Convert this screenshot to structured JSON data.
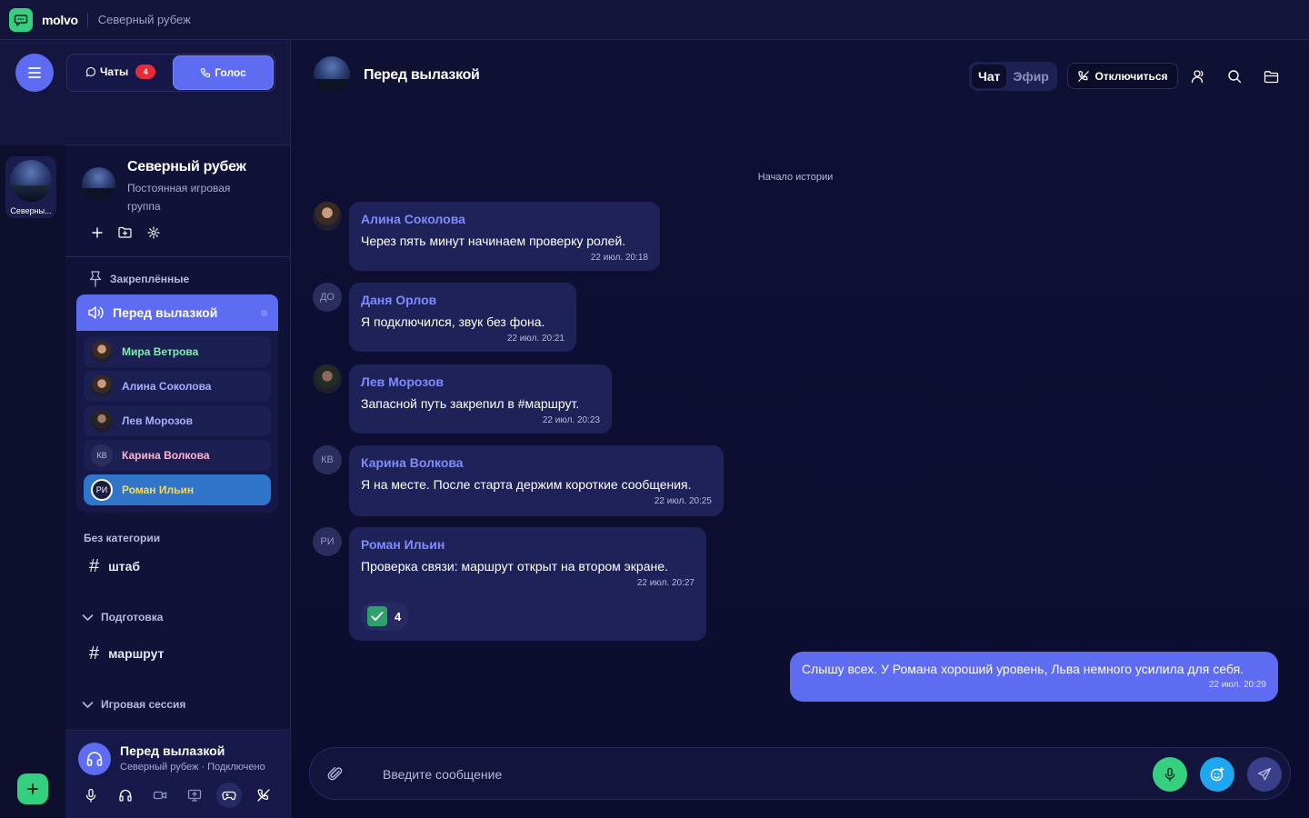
{
  "app": {
    "brand": "molvo",
    "context_title": "Северный рубеж"
  },
  "colors": {
    "accent": "#5d6cf0",
    "green": "#35d07f",
    "badge_red": "#e62b38",
    "active_user": "#2f75c9"
  },
  "mode": {
    "chats_label": "Чаты",
    "chats_count": "4",
    "voice_label": "Голос"
  },
  "server": {
    "rail_name": "Северны...",
    "title": "Северный рубеж",
    "description": "Постоянная игровая группа"
  },
  "pinned": {
    "label": "Закреплённые",
    "voice_channel": "Перед вылазкой",
    "participants": [
      {
        "name": "Мира Ветрова",
        "color": "#7ff0a8",
        "initials": ""
      },
      {
        "name": "Алина Соколова",
        "color": "#a5aeff",
        "initials": ""
      },
      {
        "name": "Лев Морозов",
        "color": "#a5aeff",
        "initials": ""
      },
      {
        "name": "Карина Волкова",
        "color": "#ffb3d0",
        "initials": "КВ"
      },
      {
        "name": "Роман Ильин",
        "color": "#ffd84d",
        "initials": "РИ"
      }
    ]
  },
  "categories": {
    "uncategorized": "Без категории",
    "ch_shtab": "штаб",
    "prep": "Подготовка",
    "ch_route": "маршрут",
    "session": "Игровая сессия"
  },
  "voice_panel": {
    "title": "Перед вылазкой",
    "subtitle": "Северный рубеж · Подключено"
  },
  "chat": {
    "title": "Перед вылазкой",
    "tab_chat": "Чат",
    "tab_live": "Эфир",
    "disconnect": "Отключиться",
    "history_start": "Начало истории",
    "messages": [
      {
        "author": "Алина Соколова",
        "initials": "",
        "text": "Через пять минут начинаем проверку ролей.",
        "time": "22 июл. 20:18"
      },
      {
        "author": "Даня Орлов",
        "initials": "ДО",
        "text": "Я подключился, звук без фона.",
        "time": "22 июл. 20:21"
      },
      {
        "author": "Лев Морозов",
        "initials": "",
        "text": "Запасной путь закрепил в #маршрут.",
        "time": "22 июл. 20:23"
      },
      {
        "author": "Карина Волкова",
        "initials": "КВ",
        "text": "Я на месте. После старта держим короткие сообщения.",
        "time": "22 июл. 20:25"
      },
      {
        "author": "Роман Ильин",
        "initials": "РИ",
        "text": "Проверка связи: маршрут открыт на втором экране.",
        "time": "22 июл. 20:27",
        "reaction_count": "4"
      }
    ],
    "own_message": {
      "text": "Слышу всех. У Романа хороший уровень, Льва немного усилила для себя.",
      "time": "22 июл. 20:29"
    },
    "composer_placeholder": "Введите сообщение"
  }
}
